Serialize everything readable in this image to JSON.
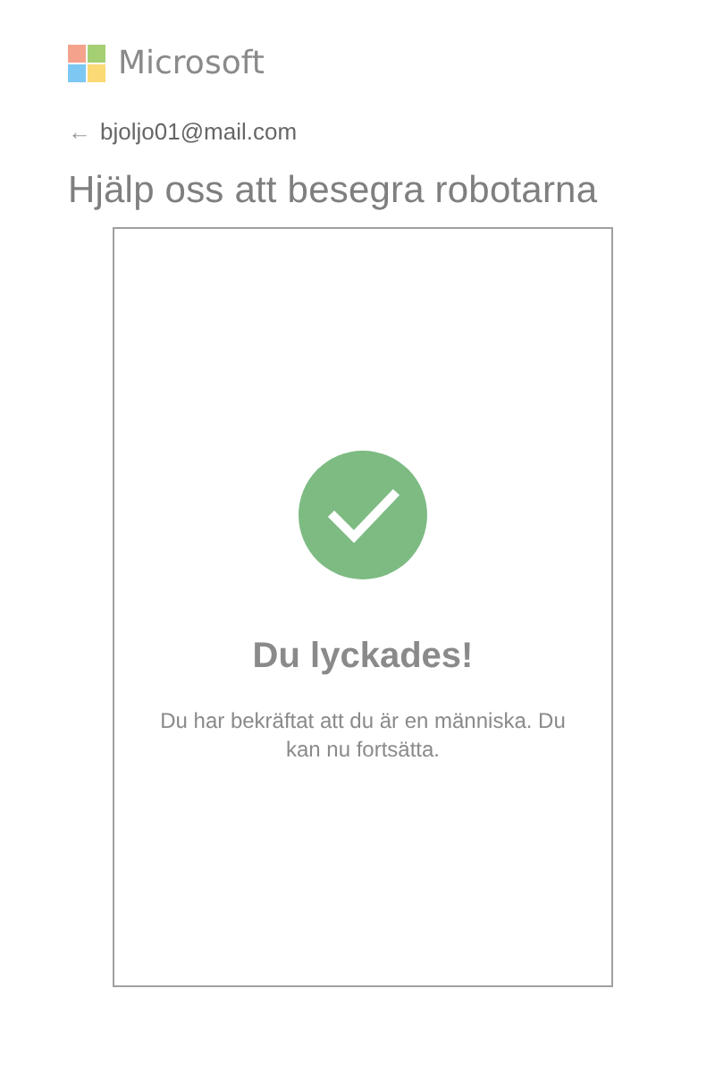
{
  "brand": {
    "name": "Microsoft"
  },
  "account": {
    "back_symbol": "←",
    "email": "bjoljo01@mail.com"
  },
  "title": "Hjälp oss att besegra robotarna",
  "result": {
    "succeeded": true,
    "heading": "Du lyckades!",
    "message": "Du har bekräftat att du är en människa. Du kan nu fortsätta."
  }
}
